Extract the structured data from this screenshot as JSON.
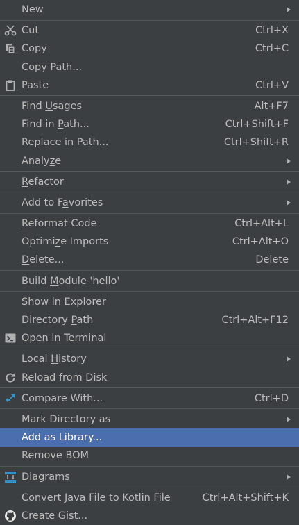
{
  "menu": {
    "new": {
      "label": "New"
    },
    "cut": {
      "pre": "Cu",
      "ul": "t",
      "post": "",
      "shortcut": "Ctrl+X",
      "icon": "scissors-icon"
    },
    "copy": {
      "pre": "",
      "ul": "C",
      "post": "opy",
      "shortcut": "Ctrl+C",
      "icon": "copy-icon"
    },
    "copy_path": {
      "label": "Copy Path..."
    },
    "paste": {
      "pre": "",
      "ul": "P",
      "post": "aste",
      "shortcut": "Ctrl+V",
      "icon": "clipboard-icon"
    },
    "find_usages": {
      "pre": "Find ",
      "ul": "U",
      "post": "sages",
      "shortcut": "Alt+F7"
    },
    "find_in_path": {
      "pre": "Find in ",
      "ul": "P",
      "post": "ath...",
      "shortcut": "Ctrl+Shift+F"
    },
    "replace_in_path": {
      "pre": "Repl",
      "ul": "a",
      "post": "ce in Path...",
      "shortcut": "Ctrl+Shift+R"
    },
    "analyze": {
      "pre": "Analy",
      "ul": "z",
      "post": "e"
    },
    "refactor": {
      "pre": "",
      "ul": "R",
      "post": "efactor"
    },
    "add_to_favorites": {
      "pre": "Add to F",
      "ul": "a",
      "post": "vorites"
    },
    "reformat_code": {
      "pre": "",
      "ul": "R",
      "post": "eformat Code",
      "shortcut": "Ctrl+Alt+L"
    },
    "optimize_imports": {
      "pre": "Optimi",
      "ul": "z",
      "post": "e Imports",
      "shortcut": "Ctrl+Alt+O"
    },
    "delete": {
      "pre": "",
      "ul": "D",
      "post": "elete...",
      "shortcut": "Delete"
    },
    "build_module": {
      "pre": "Build ",
      "ul": "M",
      "post": "odule 'hello'"
    },
    "show_in_explorer": {
      "label": "Show in Explorer"
    },
    "directory_path": {
      "pre": "Directory ",
      "ul": "P",
      "post": "ath",
      "shortcut": "Ctrl+Alt+F12"
    },
    "open_in_terminal": {
      "label": "Open in Terminal",
      "icon": "terminal-icon"
    },
    "local_history": {
      "pre": "Local ",
      "ul": "H",
      "post": "istory"
    },
    "reload_from_disk": {
      "label": "Reload from Disk",
      "icon": "reload-icon"
    },
    "compare_with": {
      "label": "Compare With...",
      "shortcut": "Ctrl+D",
      "icon": "compare-arrows-icon"
    },
    "mark_directory_as": {
      "label": "Mark Directory as"
    },
    "add_as_library": {
      "label": "Add as Library..."
    },
    "remove_bom": {
      "label": "Remove BOM"
    },
    "diagrams": {
      "label": "Diagrams",
      "icon": "diagram-icon"
    },
    "convert_java_kotlin": {
      "label": "Convert Java File to Kotlin File",
      "shortcut": "Ctrl+Alt+Shift+K"
    },
    "create_gist": {
      "label": "Create Gist...",
      "icon": "github-icon"
    }
  },
  "colors": {
    "background": "#3c3f41",
    "text": "#bbbbbb",
    "selection": "#4b6eaf",
    "separator": "#515658"
  }
}
